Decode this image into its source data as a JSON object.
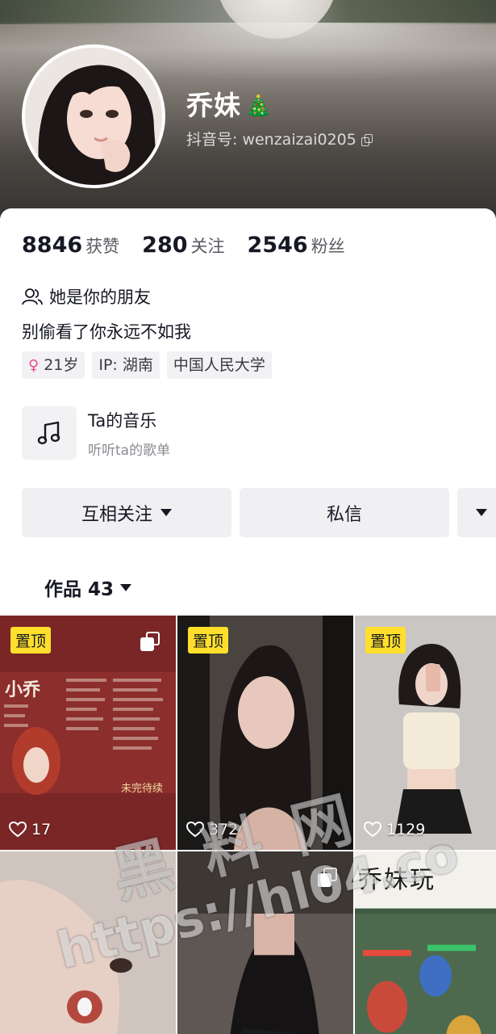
{
  "profile": {
    "nickname": "乔妹",
    "nickname_emoji": "🎄",
    "douyin_id_label": "抖音号: wenzaizai0205"
  },
  "stats": [
    {
      "value": "8846",
      "label": "获赞"
    },
    {
      "value": "280",
      "label": "关注"
    },
    {
      "value": "2546",
      "label": "粉丝"
    }
  ],
  "friend_text": "她是你的朋友",
  "bio": "别偷看了你永远不如我",
  "tags": {
    "age": "21岁",
    "ip": "IP: 湖南",
    "school": "中国人民大学"
  },
  "music": {
    "title": "Ta的音乐",
    "subtitle": "听听ta的歌单"
  },
  "actions": {
    "follow": "互相关注",
    "message": "私信"
  },
  "works_tab": {
    "label": "作品 43"
  },
  "grid": {
    "pin_label": "置顶",
    "items": [
      {
        "likes": "17"
      },
      {
        "likes": "372"
      },
      {
        "likes": "1129"
      }
    ],
    "cell_a_title": "小乔",
    "cell_a_caption": "未完待续",
    "cell_f_title": "乔妹玩"
  },
  "watermark": {
    "line1": "黑料网",
    "line2": "https://hl04.co"
  },
  "colors": {
    "pin_yellow": "#ffdf2b",
    "gender_pink": "#f0488b",
    "button_gray": "#f0f0f2",
    "text_dark": "#161823"
  }
}
